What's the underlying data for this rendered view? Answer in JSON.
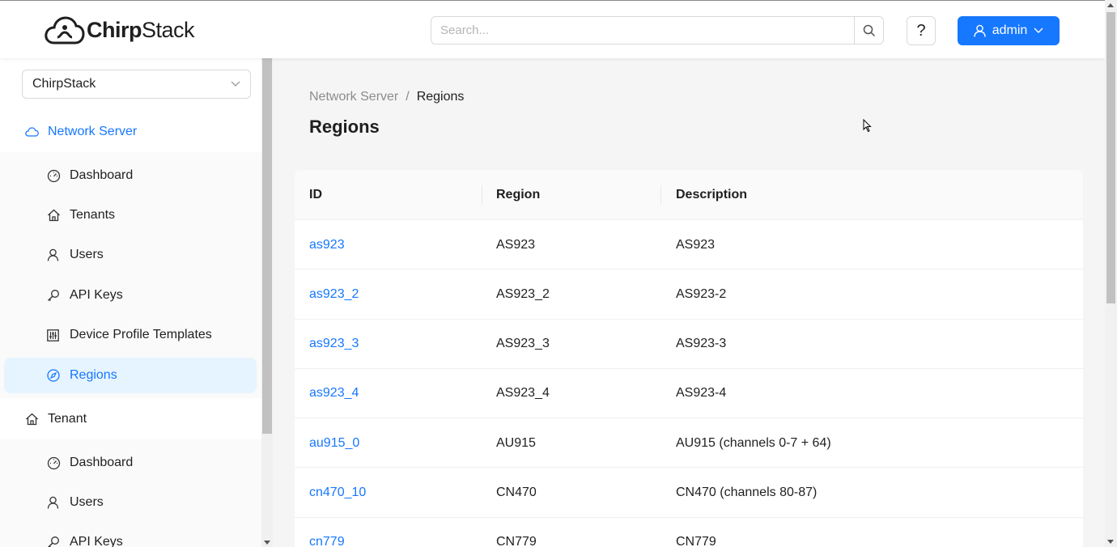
{
  "header": {
    "logo_part1": "Chirp",
    "logo_part2": "Stack",
    "search_placeholder": "Search...",
    "help_label": "?",
    "user_label": "admin"
  },
  "sidebar": {
    "tenant_select": "ChirpStack",
    "network_server": {
      "label": "Network Server",
      "items": [
        {
          "label": "Dashboard",
          "icon": "dashboard-icon"
        },
        {
          "label": "Tenants",
          "icon": "home-icon"
        },
        {
          "label": "Users",
          "icon": "user-icon"
        },
        {
          "label": "API Keys",
          "icon": "key-icon"
        },
        {
          "label": "Device Profile Templates",
          "icon": "sliders-icon"
        },
        {
          "label": "Regions",
          "icon": "compass-icon",
          "active": true
        }
      ]
    },
    "tenant": {
      "label": "Tenant",
      "items": [
        {
          "label": "Dashboard",
          "icon": "dashboard-icon"
        },
        {
          "label": "Users",
          "icon": "user-icon"
        },
        {
          "label": "API Keys",
          "icon": "key-icon"
        }
      ]
    }
  },
  "breadcrumb": {
    "parent": "Network Server",
    "separator": "/",
    "current": "Regions"
  },
  "page_title": "Regions",
  "table": {
    "columns": [
      "ID",
      "Region",
      "Description"
    ],
    "rows": [
      {
        "id": "as923",
        "region": "AS923",
        "description": "AS923"
      },
      {
        "id": "as923_2",
        "region": "AS923_2",
        "description": "AS923-2"
      },
      {
        "id": "as923_3",
        "region": "AS923_3",
        "description": "AS923-3"
      },
      {
        "id": "as923_4",
        "region": "AS923_4",
        "description": "AS923-4"
      },
      {
        "id": "au915_0",
        "region": "AU915",
        "description": "AU915 (channels 0-7 + 64)"
      },
      {
        "id": "cn470_10",
        "region": "CN470",
        "description": "CN470 (channels 80-87)"
      },
      {
        "id": "cn779",
        "region": "CN779",
        "description": "CN779"
      }
    ]
  },
  "colors": {
    "accent": "#1677ff",
    "active_bg": "#e6f4ff"
  }
}
